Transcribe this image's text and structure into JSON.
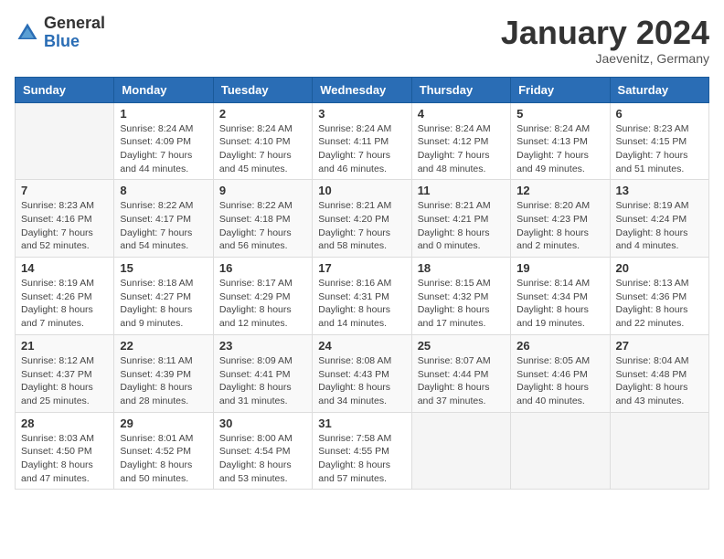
{
  "logo": {
    "general": "General",
    "blue": "Blue"
  },
  "header": {
    "month": "January 2024",
    "location": "Jaevenitz, Germany"
  },
  "days_of_week": [
    "Sunday",
    "Monday",
    "Tuesday",
    "Wednesday",
    "Thursday",
    "Friday",
    "Saturday"
  ],
  "weeks": [
    [
      {
        "day": "",
        "info": ""
      },
      {
        "day": "1",
        "info": "Sunrise: 8:24 AM\nSunset: 4:09 PM\nDaylight: 7 hours\nand 44 minutes."
      },
      {
        "day": "2",
        "info": "Sunrise: 8:24 AM\nSunset: 4:10 PM\nDaylight: 7 hours\nand 45 minutes."
      },
      {
        "day": "3",
        "info": "Sunrise: 8:24 AM\nSunset: 4:11 PM\nDaylight: 7 hours\nand 46 minutes."
      },
      {
        "day": "4",
        "info": "Sunrise: 8:24 AM\nSunset: 4:12 PM\nDaylight: 7 hours\nand 48 minutes."
      },
      {
        "day": "5",
        "info": "Sunrise: 8:24 AM\nSunset: 4:13 PM\nDaylight: 7 hours\nand 49 minutes."
      },
      {
        "day": "6",
        "info": "Sunrise: 8:23 AM\nSunset: 4:15 PM\nDaylight: 7 hours\nand 51 minutes."
      }
    ],
    [
      {
        "day": "7",
        "info": "Sunrise: 8:23 AM\nSunset: 4:16 PM\nDaylight: 7 hours\nand 52 minutes."
      },
      {
        "day": "8",
        "info": "Sunrise: 8:22 AM\nSunset: 4:17 PM\nDaylight: 7 hours\nand 54 minutes."
      },
      {
        "day": "9",
        "info": "Sunrise: 8:22 AM\nSunset: 4:18 PM\nDaylight: 7 hours\nand 56 minutes."
      },
      {
        "day": "10",
        "info": "Sunrise: 8:21 AM\nSunset: 4:20 PM\nDaylight: 7 hours\nand 58 minutes."
      },
      {
        "day": "11",
        "info": "Sunrise: 8:21 AM\nSunset: 4:21 PM\nDaylight: 8 hours\nand 0 minutes."
      },
      {
        "day": "12",
        "info": "Sunrise: 8:20 AM\nSunset: 4:23 PM\nDaylight: 8 hours\nand 2 minutes."
      },
      {
        "day": "13",
        "info": "Sunrise: 8:19 AM\nSunset: 4:24 PM\nDaylight: 8 hours\nand 4 minutes."
      }
    ],
    [
      {
        "day": "14",
        "info": "Sunrise: 8:19 AM\nSunset: 4:26 PM\nDaylight: 8 hours\nand 7 minutes."
      },
      {
        "day": "15",
        "info": "Sunrise: 8:18 AM\nSunset: 4:27 PM\nDaylight: 8 hours\nand 9 minutes."
      },
      {
        "day": "16",
        "info": "Sunrise: 8:17 AM\nSunset: 4:29 PM\nDaylight: 8 hours\nand 12 minutes."
      },
      {
        "day": "17",
        "info": "Sunrise: 8:16 AM\nSunset: 4:31 PM\nDaylight: 8 hours\nand 14 minutes."
      },
      {
        "day": "18",
        "info": "Sunrise: 8:15 AM\nSunset: 4:32 PM\nDaylight: 8 hours\nand 17 minutes."
      },
      {
        "day": "19",
        "info": "Sunrise: 8:14 AM\nSunset: 4:34 PM\nDaylight: 8 hours\nand 19 minutes."
      },
      {
        "day": "20",
        "info": "Sunrise: 8:13 AM\nSunset: 4:36 PM\nDaylight: 8 hours\nand 22 minutes."
      }
    ],
    [
      {
        "day": "21",
        "info": "Sunrise: 8:12 AM\nSunset: 4:37 PM\nDaylight: 8 hours\nand 25 minutes."
      },
      {
        "day": "22",
        "info": "Sunrise: 8:11 AM\nSunset: 4:39 PM\nDaylight: 8 hours\nand 28 minutes."
      },
      {
        "day": "23",
        "info": "Sunrise: 8:09 AM\nSunset: 4:41 PM\nDaylight: 8 hours\nand 31 minutes."
      },
      {
        "day": "24",
        "info": "Sunrise: 8:08 AM\nSunset: 4:43 PM\nDaylight: 8 hours\nand 34 minutes."
      },
      {
        "day": "25",
        "info": "Sunrise: 8:07 AM\nSunset: 4:44 PM\nDaylight: 8 hours\nand 37 minutes."
      },
      {
        "day": "26",
        "info": "Sunrise: 8:05 AM\nSunset: 4:46 PM\nDaylight: 8 hours\nand 40 minutes."
      },
      {
        "day": "27",
        "info": "Sunrise: 8:04 AM\nSunset: 4:48 PM\nDaylight: 8 hours\nand 43 minutes."
      }
    ],
    [
      {
        "day": "28",
        "info": "Sunrise: 8:03 AM\nSunset: 4:50 PM\nDaylight: 8 hours\nand 47 minutes."
      },
      {
        "day": "29",
        "info": "Sunrise: 8:01 AM\nSunset: 4:52 PM\nDaylight: 8 hours\nand 50 minutes."
      },
      {
        "day": "30",
        "info": "Sunrise: 8:00 AM\nSunset: 4:54 PM\nDaylight: 8 hours\nand 53 minutes."
      },
      {
        "day": "31",
        "info": "Sunrise: 7:58 AM\nSunset: 4:55 PM\nDaylight: 8 hours\nand 57 minutes."
      },
      {
        "day": "",
        "info": ""
      },
      {
        "day": "",
        "info": ""
      },
      {
        "day": "",
        "info": ""
      }
    ]
  ]
}
